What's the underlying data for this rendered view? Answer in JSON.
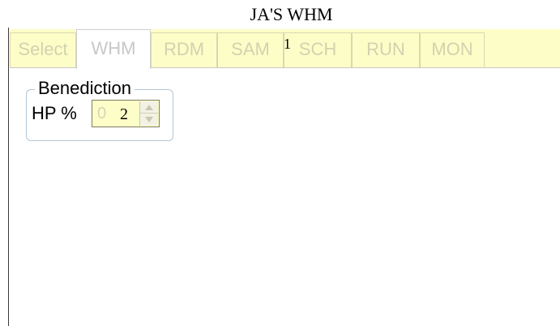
{
  "window": {
    "title": "JA'S WHM"
  },
  "tabs": [
    {
      "label": "Select"
    },
    {
      "label": "WHM"
    },
    {
      "label": "RDM"
    },
    {
      "label": "SAM"
    },
    {
      "label": "SCH"
    },
    {
      "label": "RUN"
    },
    {
      "label": "MON"
    }
  ],
  "active_tab": "WHM",
  "stray_marker": "1",
  "group": {
    "title": "Benediction",
    "hp_label": "HP %",
    "spinner_placeholder": "0",
    "spinner_value": "2"
  },
  "colors": {
    "tab_background": "#fdfdc8",
    "tab_text": "#d2d2b0",
    "group_border": "#b4c5d6"
  },
  "icons": {
    "spin_up": "triangle-up-icon",
    "spin_down": "triangle-down-icon"
  }
}
